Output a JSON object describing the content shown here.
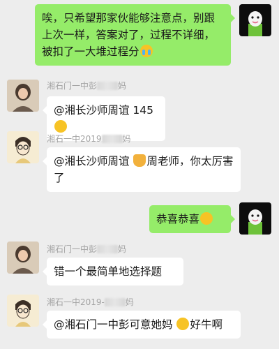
{
  "messages": [
    {
      "side": "right",
      "text": "唉，只希望那家伙能够注意点，别跟上次一样，答案对了，过程不详细，被扣了一大堆过程分",
      "emoji": "crying-emoji"
    },
    {
      "side": "left",
      "sender": "湘石门一中彭",
      "sender_suffix": "妈",
      "text": "@湘长沙师周谊 145",
      "emoji": "thinking-emoji"
    },
    {
      "side": "left",
      "sender": "湘石一中2019",
      "sender_suffix": "妈",
      "text_before": "@湘长沙师周谊 ",
      "emoji": "thumbs-up-emoji",
      "text": "周老师，你太厉害了"
    },
    {
      "side": "right",
      "text": "恭喜恭喜",
      "emoji": "thinking-emoji"
    },
    {
      "side": "left",
      "sender": "湘石门一中彭",
      "sender_suffix": "妈",
      "text": "错一个最简单地选择题"
    },
    {
      "side": "left",
      "sender": "湘石一中2019-",
      "sender_suffix": "妈",
      "text": "@湘石门一中彭可意她妈 ",
      "emoji": "surprised-emoji",
      "text_after": "好牛啊"
    }
  ]
}
